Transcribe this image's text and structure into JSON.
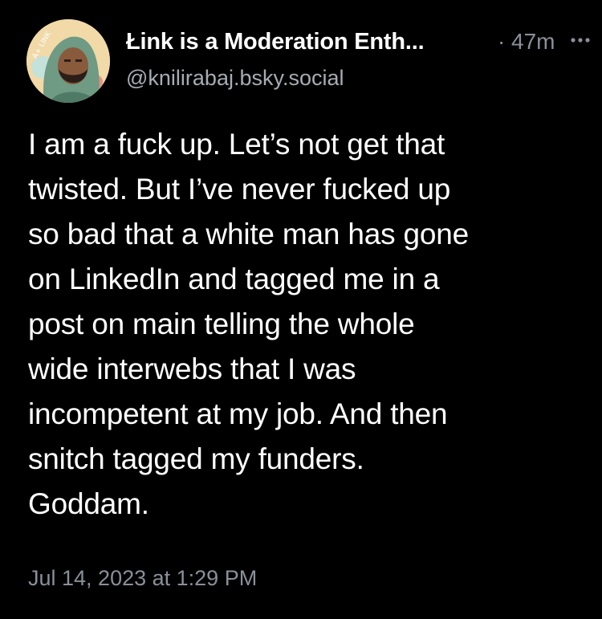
{
  "post": {
    "author": {
      "display_name": "Łink is a Moderation Enth...",
      "handle": "@knilirabaj.bsky.social",
      "avatar_text": "A+ LINK"
    },
    "meta_separator": "·",
    "relative_time": "47m",
    "more_icon": "ellipsis-icon",
    "text": "I am a fuck up. Let’s not get that\ntwisted. But I’ve never fucked up\nso bad that a white man has gone\non LinkedIn and tagged me in a\npost on main telling the whole\nwide interwebs that I was\nincompetent at my job. And then\nsnitch tagged my funders.\nGoddam.",
    "date": "Jul 14, 2023 at 1:29 PM"
  },
  "colors": {
    "background": "#000000",
    "primary_text": "#ffffff",
    "secondary_text": "#8a8f99",
    "avatar_bg": "#f1d9a8",
    "avatar_hood": "#6f9a83"
  }
}
